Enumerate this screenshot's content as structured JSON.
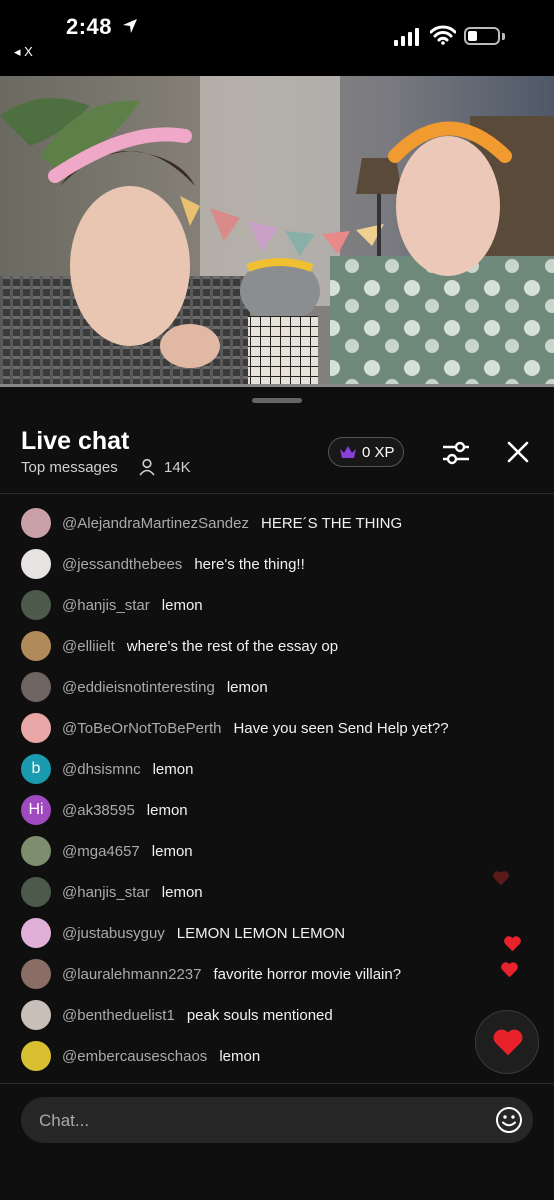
{
  "status_bar": {
    "time": "2:48",
    "back_app": "X"
  },
  "chat": {
    "title": "Live chat",
    "subtitle": "Top messages",
    "viewers": "14K",
    "xp": "0 XP",
    "input_placeholder": "Chat...",
    "messages": [
      {
        "author": "@AlejandraMartinezSandez",
        "text": "HERE´S THE THING",
        "avatar_color": "#c9a0a6"
      },
      {
        "author": "@jessandthebees",
        "text": "here's the thing!!",
        "avatar_color": "#e8e3e3"
      },
      {
        "author": "@hanjis_star",
        "text": "lemon",
        "avatar_color": "#4b5a4a"
      },
      {
        "author": "@elliielt",
        "text": "where's the rest of the essay op",
        "avatar_color": "#b08a5a"
      },
      {
        "author": "@eddieisnotinteresting",
        "text": "lemon",
        "avatar_color": "#6e6460"
      },
      {
        "author": "@ToBeOrNotToBePerth",
        "text": "Have you seen Send Help yet??",
        "avatar_color": "#e8a6a6"
      },
      {
        "author": "@dhsismnc",
        "text": "lemon",
        "avatar_color": "#1a9bb0",
        "avatar_letter": "b"
      },
      {
        "author": "@ak38595",
        "text": "lemon",
        "avatar_color": "#a04ac0",
        "avatar_letter": "Hi"
      },
      {
        "author": "@mga4657",
        "text": "lemon",
        "avatar_color": "#7c8e6e"
      },
      {
        "author": "@hanjis_star",
        "text": "lemon",
        "avatar_color": "#4b5a4a"
      },
      {
        "author": "@justabusyguy",
        "text": "LEMON LEMON LEMON",
        "avatar_color": "#e0b0d8"
      },
      {
        "author": "@lauralehmann2237",
        "text": "favorite horror movie villain?",
        "avatar_color": "#8a6e66"
      },
      {
        "author": "@bentheduelist1",
        "text": "peak souls mentioned",
        "avatar_color": "#c8c0b8"
      },
      {
        "author": "@embercauseschaos",
        "text": "lemon",
        "avatar_color": "#d8c030"
      }
    ]
  },
  "colors": {
    "accent_heart": "#e8212a",
    "crown": "#8b3fd9"
  }
}
